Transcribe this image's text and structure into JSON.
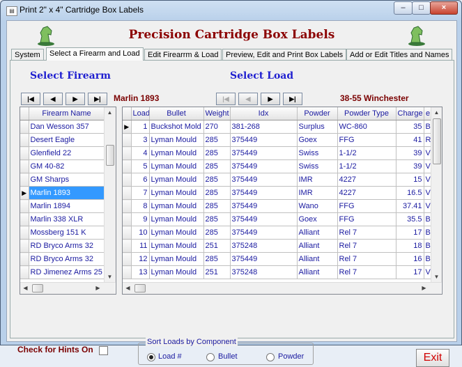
{
  "window": {
    "title": "Print 2\" x 4\" Cartridge Box Labels",
    "minimize": "–",
    "maximize": "□",
    "close": "×"
  },
  "app": {
    "heading": "Precision Cartridge Box Labels"
  },
  "tabs": [
    {
      "label": "System"
    },
    {
      "label": "Select a Firearm and Load"
    },
    {
      "label": "Edit Firearrm & Load"
    },
    {
      "label": "Preview, Edit and Print Box Labels"
    },
    {
      "label": "Add or Edit Titles and Names"
    }
  ],
  "firearm": {
    "heading": "Select Firearm",
    "current": "Marlin 1893",
    "nav": {
      "first": "|◀",
      "prev": "◀",
      "next": "▶",
      "last": "▶|"
    },
    "column": "Firearm Name",
    "rows": [
      "Dan Wesson 357",
      "Desert Eagle",
      "Glenfield 22",
      "GM 40-82",
      "GM Sharps",
      "Marlin 1893",
      "Marlin 1894",
      "Marlin 338 XLR",
      "Mossberg 151 K",
      "RD Bryco Arms 32",
      "RD Bryco Arms 32",
      "RD Jimenez Arms 25"
    ],
    "selected_index": 5
  },
  "load": {
    "heading": "Select Load",
    "current": "38-55 Winchester",
    "nav": {
      "first": "|◀",
      "prev": "◀",
      "next": "▶",
      "last": "▶|"
    },
    "columns": [
      "Load",
      "Bullet",
      "Weight",
      "Idx",
      "Powder",
      "Powder Type",
      "Charge",
      "e"
    ],
    "rows": [
      [
        "1",
        "Buckshot Mold",
        "270",
        "381-268",
        "Surplus",
        "WC-860",
        "35",
        "B"
      ],
      [
        "3",
        "Lyman Mould",
        "285",
        "375449",
        "Goex",
        "FFG",
        "41",
        "R"
      ],
      [
        "4",
        "Lyman Mould",
        "285",
        "375449",
        "Swiss",
        "1-1/2",
        "39",
        "V"
      ],
      [
        "5",
        "Lyman Mould",
        "285",
        "375449",
        "Swiss",
        "1-1/2",
        "39",
        "V"
      ],
      [
        "6",
        "Lyman Mould",
        "285",
        "375449",
        "IMR",
        "4227",
        "15",
        "V"
      ],
      [
        "7",
        "Lyman Mould",
        "285",
        "375449",
        "IMR",
        "4227",
        "16.5",
        "V"
      ],
      [
        "8",
        "Lyman Mould",
        "285",
        "375449",
        "Wano",
        "FFG",
        "37.41",
        "V"
      ],
      [
        "9",
        "Lyman Mould",
        "285",
        "375449",
        "Goex",
        "FFG",
        "35.5",
        "B"
      ],
      [
        "10",
        "Lyman Mould",
        "285",
        "375449",
        "Alliant",
        "Rel 7",
        "17",
        "B"
      ],
      [
        "11",
        "Lyman Mould",
        "251",
        "375248",
        "Alliant",
        "Rel 7",
        "18",
        "B"
      ],
      [
        "12",
        "Lyman Mould",
        "285",
        "375449",
        "Alliant",
        "Rel 7",
        "16",
        "B"
      ],
      [
        "13",
        "Lyman Mould",
        "251",
        "375248",
        "Alliant",
        "Rel 7",
        "17",
        "V"
      ]
    ]
  },
  "hints": {
    "label": "Check for Hints On",
    "checked": false
  },
  "sort": {
    "legend": "Sort Loads by Component",
    "options": [
      "Load #",
      "Bullet",
      "Powder"
    ],
    "selected": "Load #"
  },
  "exit_label": "Exit",
  "colors": {
    "heading": "#8b0000",
    "section": "#1f1fd0",
    "selection": "#3399ff",
    "exit": "#d00000"
  }
}
